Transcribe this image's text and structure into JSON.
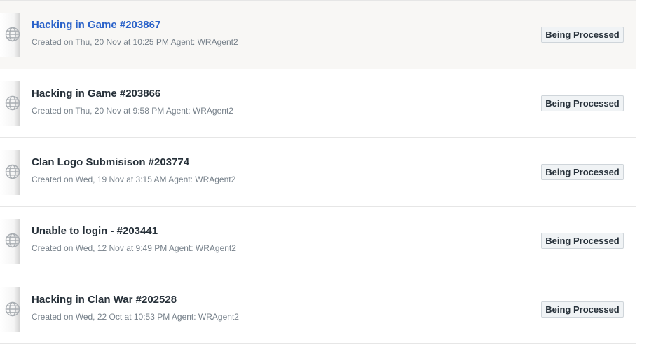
{
  "tickets": [
    {
      "title": "Hacking in Game #203867",
      "meta": "Created on Thu, 20 Nov at 10:25 PM Agent: WRAgent2",
      "status": "Being Processed",
      "hovered": true
    },
    {
      "title": "Hacking in Game #203866",
      "meta": "Created on Thu, 20 Nov at 9:58 PM Agent: WRAgent2",
      "status": "Being Processed"
    },
    {
      "title": "Clan Logo Submisison #203774",
      "meta": "Created on Wed, 19 Nov at 3:15 AM Agent: WRAgent2",
      "status": "Being Processed"
    },
    {
      "title": "Unable to login - #203441",
      "meta": "Created on Wed, 12 Nov at 9:49 PM Agent: WRAgent2",
      "status": "Being Processed"
    },
    {
      "title": "Hacking in Clan War #202528",
      "meta": "Created on Wed, 22 Oct at 10:53 PM Agent: WRAgent2",
      "status": "Being Processed"
    }
  ],
  "icons": {
    "ticket_source": "globe-icon"
  },
  "colors": {
    "link": "#2a62c9",
    "title": "#27313a",
    "meta": "#76808a",
    "badge_bg": "#f0f3f5",
    "badge_border": "#cfd5da"
  }
}
